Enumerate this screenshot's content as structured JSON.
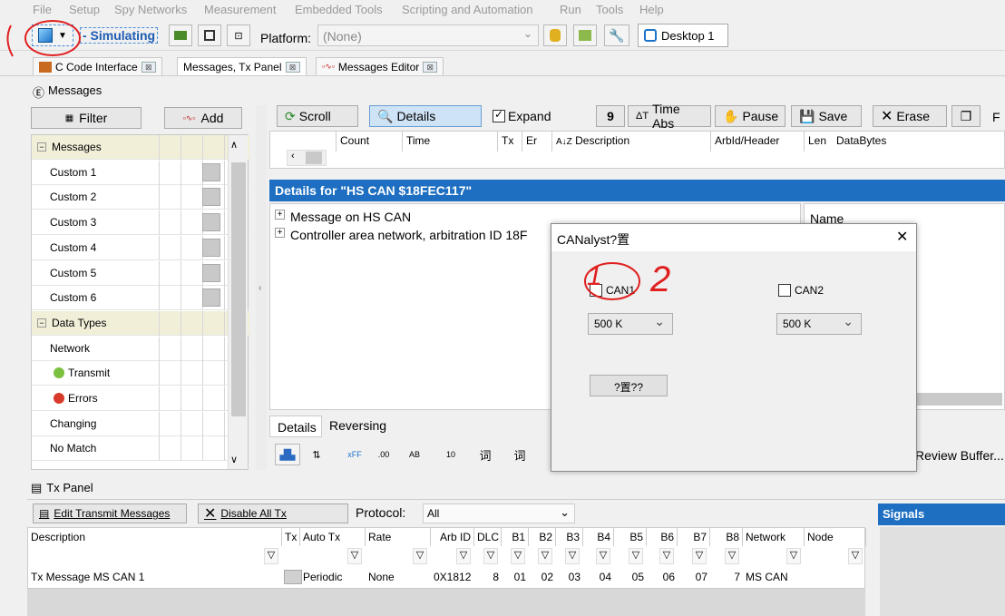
{
  "menu": [
    "File",
    "Setup",
    "Spy Networks",
    "Measurement",
    "Embedded Tools",
    "Scripting and Automation",
    "Run",
    "Tools",
    "Help"
  ],
  "toolbar": {
    "mode_label": "- Simulating",
    "platform_label": "Platform:",
    "platform_value": "(None)",
    "desktop_label": "Desktop 1"
  },
  "tabs": [
    "C Code Interface",
    "Messages, Tx Panel",
    "Messages Editor"
  ],
  "messages_section": "Messages",
  "left": {
    "filter_label": "Filter",
    "add_label": "Add",
    "tree": [
      {
        "label": "Messages",
        "kind": "group"
      },
      {
        "label": "Custom 1",
        "kind": "item"
      },
      {
        "label": "Custom 2",
        "kind": "item"
      },
      {
        "label": "Custom 3",
        "kind": "item"
      },
      {
        "label": "Custom 4",
        "kind": "item"
      },
      {
        "label": "Custom 5",
        "kind": "item"
      },
      {
        "label": "Custom 6",
        "kind": "item"
      },
      {
        "label": "Data Types",
        "kind": "group"
      },
      {
        "label": "Network",
        "kind": "plain"
      },
      {
        "label": "Transmit",
        "kind": "green"
      },
      {
        "label": "Errors",
        "kind": "red"
      },
      {
        "label": "Changing",
        "kind": "plain"
      },
      {
        "label": "No Match",
        "kind": "plain"
      }
    ]
  },
  "msgtoolbar": {
    "scroll": "Scroll",
    "details": "Details",
    "expand": "Expand",
    "time_abs": "Time Abs",
    "pause": "Pause",
    "save": "Save",
    "erase": "Erase",
    "f": "F"
  },
  "columns": [
    "Count",
    "Time",
    "Tx",
    "Er",
    "Description",
    "ArbId/Header",
    "Len",
    "DataBytes"
  ],
  "details": {
    "header": "Details for \"HS CAN $18FEC117\"",
    "rows": [
      "Message on HS CAN",
      "Controller area network, arbitration ID 18F"
    ],
    "name_col": "Name",
    "bottom_tabs": [
      "Details",
      "Reversing"
    ],
    "format_buttons": [
      "xFF",
      ".00",
      "AB",
      "10",
      "词",
      "词"
    ],
    "review_buffer": "Review Buffer..."
  },
  "dialog": {
    "title": "CANalyst?置",
    "can1": "CAN1",
    "can2": "CAN2",
    "baud1": "500 K",
    "baud2": "500 K",
    "apply": "?置??",
    "close": "✕"
  },
  "annotation": {
    "digit1": "1",
    "digit2": "2"
  },
  "txpanel": {
    "title": "Tx Panel",
    "edit_btn": "Edit Transmit Messages",
    "disable_btn": "Disable All Tx",
    "protocol_label": "Protocol:",
    "protocol_value": "All",
    "signals": "Signals",
    "headers": [
      "Description",
      "Tx",
      "Auto Tx",
      "Rate",
      "Arb ID",
      "DLC",
      "B1",
      "B2",
      "B3",
      "B4",
      "B5",
      "B6",
      "B7",
      "B8",
      "Network",
      "Node"
    ],
    "row": [
      "Tx Message MS CAN 1",
      "",
      "Periodic",
      "None",
      "0X1812",
      "8",
      "01",
      "02",
      "03",
      "04",
      "05",
      "06",
      "07",
      "7",
      "MS CAN",
      ""
    ]
  }
}
